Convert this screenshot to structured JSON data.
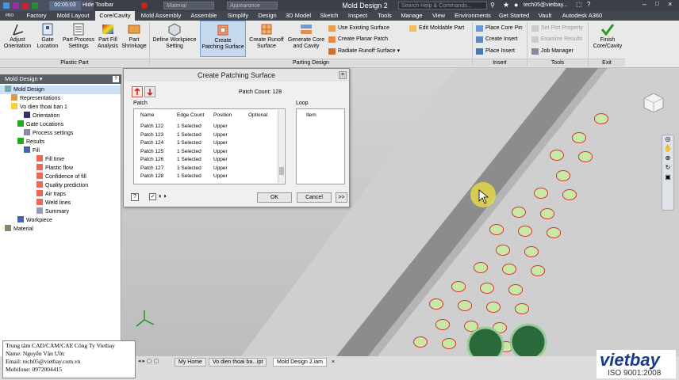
{
  "titlebar": {
    "timer": "00:05:03",
    "hide_toolbar": "Hide Toolbar",
    "material_combo": "Material",
    "appearance_combo": "Appearance",
    "app_title": "Mold Design 2",
    "search_placeholder": "Search Help & Commands...",
    "user": "tech05@vietbay..."
  },
  "tabs": [
    "PRO",
    "Factory",
    "Mold Layout",
    "Core/Cavity",
    "Mold Assembly",
    "Assemble",
    "Simplify",
    "Design",
    "3D Model",
    "Sketch",
    "Inspect",
    "Tools",
    "Manage",
    "View",
    "Environments",
    "Get Started",
    "Vault",
    "Autodesk A360"
  ],
  "ribbon": {
    "plastic_part": {
      "label": "Plastic Part",
      "buttons": [
        {
          "l1": "Adjust",
          "l2": "Orientation"
        },
        {
          "l1": "Gate",
          "l2": "Location"
        },
        {
          "l1": "Part Process",
          "l2": "Settings"
        },
        {
          "l1": "Part Fill",
          "l2": "Analysis"
        },
        {
          "l1": "Part",
          "l2": "Shrinkage"
        }
      ]
    },
    "parting_design": {
      "label": "Parting Design",
      "buttons": [
        {
          "l1": "Define Workpiece",
          "l2": "Setting"
        },
        {
          "l1": "Create",
          "l2": "Patching Surface"
        },
        {
          "l1": "Create Runoff",
          "l2": "Surface"
        },
        {
          "l1": "Generate Core",
          "l2": "and Cavity"
        }
      ],
      "small": [
        "Use Existing Surface",
        "Create Planar Patch",
        "Radiate Runoff Surface",
        "Edit Moldable Part"
      ]
    },
    "insert": {
      "label": "Insert",
      "small": [
        "Place Core Pin",
        "Create Insert",
        "Place Insert"
      ]
    },
    "tools": {
      "label": "Tools",
      "small": [
        "Set Plot Property",
        "Examine Results",
        "Job Manager"
      ]
    },
    "exit": {
      "label": "Exit",
      "l1": "Finish",
      "l2": "Core/Cavity"
    }
  },
  "browser": {
    "header": "Mold Design",
    "nodes": [
      {
        "label": "Mold Design",
        "indent": 0,
        "sel": true
      },
      {
        "label": "Representations",
        "indent": 1
      },
      {
        "label": "Vo dien thoai ban 1",
        "indent": 1
      },
      {
        "label": "Orientation",
        "indent": 3
      },
      {
        "label": "Gate Locations",
        "indent": 2
      },
      {
        "label": "Process settings",
        "indent": 3
      },
      {
        "label": "Results",
        "indent": 2
      },
      {
        "label": "Fill",
        "indent": 3
      },
      {
        "label": "Fill time",
        "indent": 5
      },
      {
        "label": "Plastic flow",
        "indent": 5
      },
      {
        "label": "Confidence of fill",
        "indent": 5
      },
      {
        "label": "Quality prediction",
        "indent": 5
      },
      {
        "label": "Air traps",
        "indent": 5
      },
      {
        "label": "Weld lines",
        "indent": 5
      },
      {
        "label": "Summary",
        "indent": 5
      },
      {
        "label": "Workpiece",
        "indent": 2
      },
      {
        "label": "Material",
        "indent": 0
      }
    ]
  },
  "dialog": {
    "title": "Create Patching Surface",
    "patch_count_label": "Patch Count: 128",
    "patch_group": "Patch",
    "loop_group": "Loop",
    "columns": [
      "Name",
      "Edge Count",
      "Position",
      "Optional"
    ],
    "loop_column": "Item",
    "rows": [
      [
        "Patch 122",
        "1 Selected",
        "Upper"
      ],
      [
        "Patch 123",
        "1 Selected",
        "Upper"
      ],
      [
        "Patch 124",
        "1 Selected",
        "Upper"
      ],
      [
        "Patch 125",
        "1 Selected",
        "Upper"
      ],
      [
        "Patch 126",
        "1 Selected",
        "Upper"
      ],
      [
        "Patch 127",
        "1 Selected",
        "Upper"
      ],
      [
        "Patch 128",
        "1 Selected",
        "Upper"
      ]
    ],
    "ok": "OK",
    "cancel": "Cancel",
    "more": ">>",
    "help": "?"
  },
  "bottom_tabs": [
    "My Home",
    "Vo dien thoai ba...ipt",
    "Mold Design 2.iam"
  ],
  "info": {
    "l1": "Trung tâm CAD/CAM/CAE Công Ty Vietbay",
    "l2": "Name: Nguyễn Văn Ước",
    "l3": "Email: tech05@vietbay.com.vn",
    "l4": "Mobifone: 0972004415"
  },
  "logo": {
    "brand": "vietbay",
    "iso": "ISO 9001:2008"
  },
  "colors": {
    "accent": "#4a7cc0",
    "hole_outline": "#d83030",
    "hole_fill": "#c8e8a8",
    "cursor_highlight": "#f0e040"
  }
}
